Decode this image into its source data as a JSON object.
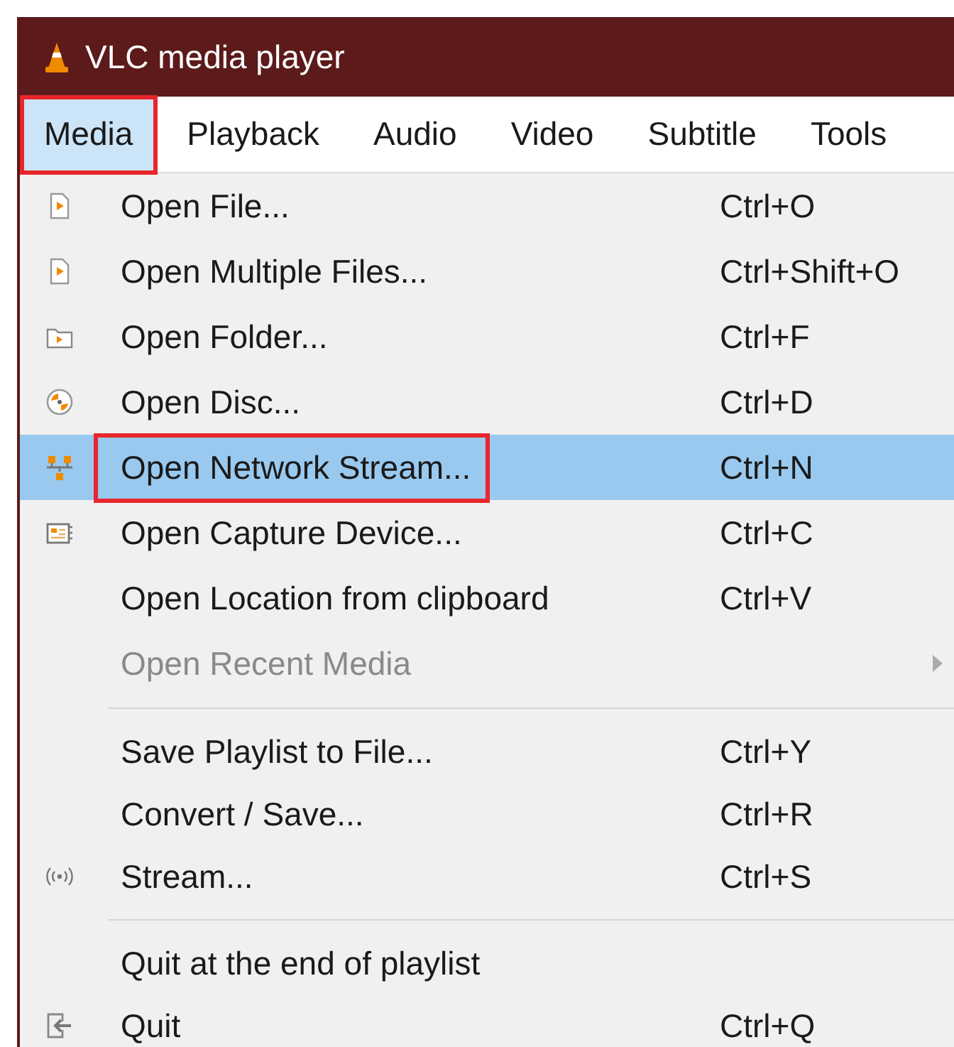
{
  "window": {
    "title": "VLC media player"
  },
  "menubar": [
    {
      "label": "Media",
      "selected": true,
      "annotated": true
    },
    {
      "label": "Playback",
      "selected": false,
      "annotated": false
    },
    {
      "label": "Audio",
      "selected": false,
      "annotated": false
    },
    {
      "label": "Video",
      "selected": false,
      "annotated": false
    },
    {
      "label": "Subtitle",
      "selected": false,
      "annotated": false
    },
    {
      "label": "Tools",
      "selected": false,
      "annotated": false
    }
  ],
  "menu": [
    {
      "kind": "item",
      "label": "Open File...",
      "shortcut": "Ctrl+O",
      "selected": false,
      "disabled": false,
      "annotated": false
    },
    {
      "kind": "item",
      "label": "Open Multiple Files...",
      "shortcut": "Ctrl+Shift+O",
      "selected": false,
      "disabled": false,
      "annotated": false
    },
    {
      "kind": "item",
      "label": "Open Folder...",
      "shortcut": "Ctrl+F",
      "selected": false,
      "disabled": false,
      "annotated": false
    },
    {
      "kind": "item",
      "label": "Open Disc...",
      "shortcut": "Ctrl+D",
      "selected": false,
      "disabled": false,
      "annotated": false
    },
    {
      "kind": "item",
      "label": "Open Network Stream...",
      "shortcut": "Ctrl+N",
      "selected": true,
      "disabled": false,
      "annotated": true
    },
    {
      "kind": "item",
      "label": "Open Capture Device...",
      "shortcut": "Ctrl+C",
      "selected": false,
      "disabled": false,
      "annotated": false
    },
    {
      "kind": "item",
      "label": "Open Location from clipboard",
      "shortcut": "Ctrl+V",
      "selected": false,
      "disabled": false,
      "annotated": false
    },
    {
      "kind": "submenu",
      "label": "Open Recent Media",
      "selected": false,
      "disabled": true,
      "annotated": false
    },
    {
      "kind": "separator"
    },
    {
      "kind": "item",
      "label": "Save Playlist to File...",
      "shortcut": "Ctrl+Y",
      "selected": false,
      "disabled": false,
      "annotated": false
    },
    {
      "kind": "item",
      "label": "Convert / Save...",
      "shortcut": "Ctrl+R",
      "selected": false,
      "disabled": false,
      "annotated": false
    },
    {
      "kind": "item",
      "label": "Stream...",
      "shortcut": "Ctrl+S",
      "selected": false,
      "disabled": false,
      "annotated": false
    },
    {
      "kind": "separator"
    },
    {
      "kind": "item",
      "label": "Quit at the end of playlist",
      "selected": false,
      "disabled": false,
      "annotated": false
    },
    {
      "kind": "item",
      "label": "Quit",
      "shortcut": "Ctrl+Q",
      "selected": false,
      "disabled": false,
      "annotated": false
    }
  ]
}
